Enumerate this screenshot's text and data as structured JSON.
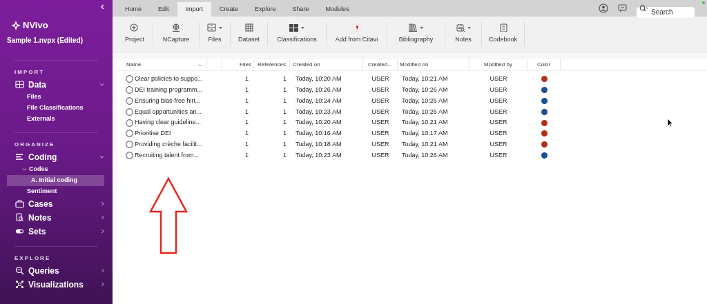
{
  "app": {
    "name": "NVivo",
    "project": "Sample 1.nvpx (Edited)"
  },
  "sidebar": {
    "sections": [
      {
        "heading": "IMPORT",
        "items": [
          {
            "label": "Data",
            "expanded": true,
            "children": [
              {
                "label": "Files",
                "selected": false
              },
              {
                "label": "File Classifications",
                "selected": false
              },
              {
                "label": "Externals",
                "selected": false
              }
            ]
          }
        ]
      },
      {
        "heading": "ORGANIZE",
        "items": [
          {
            "label": "Coding",
            "expanded": true,
            "children": [
              {
                "label": "Codes",
                "selected": false,
                "expanded": true,
                "children": [
                  {
                    "label": "A. Initial coding",
                    "selected": true
                  }
                ]
              },
              {
                "label": "Sentiment",
                "selected": false
              }
            ]
          },
          {
            "label": "Cases",
            "expanded": false
          },
          {
            "label": "Notes",
            "expanded": false
          },
          {
            "label": "Sets",
            "expanded": false
          }
        ]
      },
      {
        "heading": "EXPLORE",
        "items": [
          {
            "label": "Queries",
            "expanded": false
          },
          {
            "label": "Visualizations",
            "expanded": false
          }
        ]
      }
    ]
  },
  "tabs": [
    {
      "label": "Home",
      "selected": false
    },
    {
      "label": "Edit",
      "selected": false
    },
    {
      "label": "Import",
      "selected": true
    },
    {
      "label": "Create",
      "selected": false
    },
    {
      "label": "Explore",
      "selected": false
    },
    {
      "label": "Share",
      "selected": false
    },
    {
      "label": "Modules",
      "selected": false
    }
  ],
  "search": {
    "placeholder": "Search"
  },
  "toolbar": [
    {
      "label": "Project",
      "dropdown": false
    },
    {
      "label": "NCapture",
      "dropdown": false
    },
    {
      "label": "Files",
      "dropdown": true
    },
    {
      "label": "Dataset",
      "dropdown": false
    },
    {
      "label": "Classifications",
      "dropdown": true
    },
    {
      "label": "Add from Citavi",
      "dropdown": false
    },
    {
      "label": "Bibliography",
      "dropdown": true
    },
    {
      "label": "Notes",
      "dropdown": true
    },
    {
      "label": "Codebook",
      "dropdown": false
    }
  ],
  "table": {
    "columns": [
      "Name",
      "Files",
      "References",
      "Created on",
      "Created...",
      "Modified on",
      "Modified by",
      "Color"
    ],
    "rows": [
      {
        "name": "Clear policies to suppo...",
        "files": "1",
        "references": "1",
        "created_on": "Today, 10:20 AM",
        "created_by": "USER",
        "modified_on": "Today, 10:21 AM",
        "modified_by": "USER",
        "color": "#b5301b"
      },
      {
        "name": "DEI training programm...",
        "files": "1",
        "references": "1",
        "created_on": "Today, 10:26 AM",
        "created_by": "USER",
        "modified_on": "Today, 10:26 AM",
        "modified_by": "USER",
        "color": "#1a5190"
      },
      {
        "name": "Ensuring bias-free hiri...",
        "files": "1",
        "references": "1",
        "created_on": "Today, 10:24 AM",
        "created_by": "USER",
        "modified_on": "Today, 10:26 AM",
        "modified_by": "USER",
        "color": "#1a5190"
      },
      {
        "name": "Equal opportunities an...",
        "files": "1",
        "references": "1",
        "created_on": "Today, 10:23 AM",
        "created_by": "USER",
        "modified_on": "Today, 10:26 AM",
        "modified_by": "USER",
        "color": "#1a5190"
      },
      {
        "name": "Having clear guideline...",
        "files": "1",
        "references": "1",
        "created_on": "Today, 10:20 AM",
        "created_by": "USER",
        "modified_on": "Today, 10:21 AM",
        "modified_by": "USER",
        "color": "#b5301b"
      },
      {
        "name": "Prioritise DEI",
        "files": "1",
        "references": "1",
        "created_on": "Today, 10:16 AM",
        "created_by": "USER",
        "modified_on": "Today, 10:17 AM",
        "modified_by": "USER",
        "color": "#b5301b"
      },
      {
        "name": "Providing crèche facilit...",
        "files": "1",
        "references": "1",
        "created_on": "Today, 10:18 AM",
        "created_by": "USER",
        "modified_on": "Today, 10:21 AM",
        "modified_by": "USER",
        "color": "#b5301b"
      },
      {
        "name": "Recruiting talent from...",
        "files": "1",
        "references": "1",
        "created_on": "Today, 10:23 AM",
        "created_by": "USER",
        "modified_on": "Today, 10:26 AM",
        "modified_by": "USER",
        "color": "#1a5190"
      }
    ]
  }
}
